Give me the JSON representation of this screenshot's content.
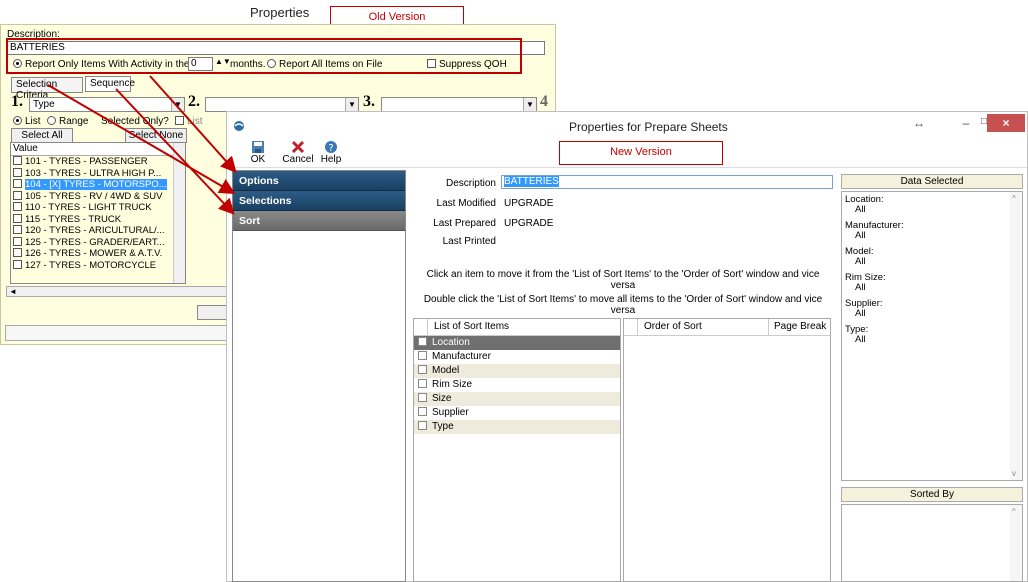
{
  "old_version": {
    "window_title": "Properties",
    "annotation": "Old Version",
    "description_label": "Description:",
    "description_value": "BATTERIES",
    "report_activity_label": "Report Only Items With Activity in the past",
    "months_value": "0",
    "months_label": "months.",
    "report_all_label": "Report All Items on File",
    "suppress_qoh_label": "Suppress QOH",
    "tabs": [
      "Selection Criteria",
      "Sequence"
    ],
    "criteria": [
      {
        "num": "1.",
        "value": "Type"
      },
      {
        "num": "2.",
        "value": ""
      },
      {
        "num": "3.",
        "value": ""
      },
      {
        "num": "4",
        "value": ""
      }
    ],
    "list_label": "List",
    "range_label": "Range",
    "selected_only_label": "Selected Only?",
    "list2_label": "List",
    "select_all": "Select All",
    "select_none": "Select None",
    "value_header": "Value",
    "values": [
      "101 - TYRES - PASSENGER",
      "103 - TYRES - ULTRA HIGH P...",
      "104 - [X] TYRES - MOTORSPO...",
      "105 - TYRES - RV / 4WD & SUV",
      "110 - TYRES - LIGHT TRUCK",
      "115 - TYRES - TRUCK",
      "120 - TYRES - ARICULTURAL/...",
      "125 - TYRES - GRADER/EART...",
      "126 - TYRES - MOWER & A.T.V.",
      "127 - TYRES - MOTORCYCLE"
    ],
    "selected_index": 2
  },
  "new_version": {
    "window_title": "Properties for Prepare Sheets",
    "annotation": "New Version",
    "resize_glyph": "↔",
    "toolbar": {
      "ok": "OK",
      "cancel": "Cancel",
      "help": "Help"
    },
    "nav": [
      "Options",
      "Selections",
      "Sort"
    ],
    "active_nav": "Sort",
    "fields": {
      "description_label": "Description",
      "description_value": "BATTERIES",
      "last_modified_label": "Last Modified",
      "last_modified_value": "UPGRADE",
      "last_prepared_label": "Last Prepared",
      "last_prepared_value": "UPGRADE",
      "last_printed_label": "Last Printed"
    },
    "instruction1": "Click an item to move it from the 'List of Sort Items' to the 'Order of Sort' window and vice versa",
    "instruction2": "Double click the 'List of Sort Items' to move all items to the 'Order of Sort' window and vice versa",
    "sort_items_header": "List of Sort Items",
    "sort_items": [
      "Location",
      "Manufacturer",
      "Model",
      "Rim Size",
      "Size",
      "Supplier",
      "Type"
    ],
    "order_header": "Order of Sort",
    "page_break_header": "Page Break",
    "data_selected_header": "Data Selected",
    "data_selected": [
      {
        "label": "Location:",
        "value": "All"
      },
      {
        "label": "Manufacturer:",
        "value": "All"
      },
      {
        "label": "Model:",
        "value": "All"
      },
      {
        "label": "Rim Size:",
        "value": "All"
      },
      {
        "label": "Supplier:",
        "value": "All"
      },
      {
        "label": "Type:",
        "value": "All"
      }
    ],
    "sorted_by_header": "Sorted By"
  },
  "colors": {
    "annotation_red": "#c00000",
    "nav_blue": "#1f4a70",
    "old_bg": "#ffffe0"
  }
}
